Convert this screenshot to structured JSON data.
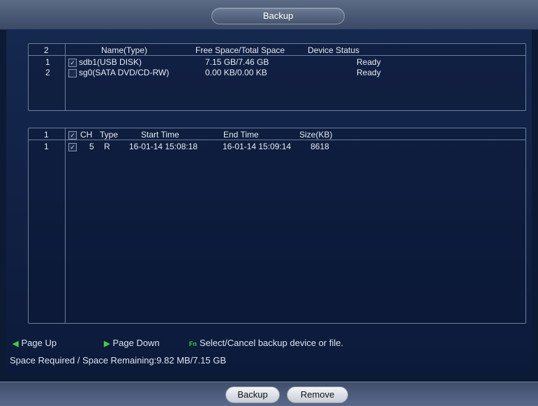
{
  "window": {
    "title": "Backup"
  },
  "devices": {
    "header": {
      "count": "2",
      "name": "Name(Type)",
      "space": "Free Space/Total Space",
      "status": "Device Status"
    },
    "rows": [
      {
        "index": "1",
        "checked": true,
        "name": "sdb1(USB DISK)",
        "space": "7.15 GB/7.46 GB",
        "status": "Ready"
      },
      {
        "index": "2",
        "checked": false,
        "name": "sg0(SATA DVD/CD-RW)",
        "space": "0.00 KB/0.00 KB",
        "status": "Ready"
      }
    ]
  },
  "files": {
    "header": {
      "count": "1",
      "checked": true,
      "ch": "CH",
      "type": "Type",
      "start": "Start Time",
      "end": "End Time",
      "size": "Size(KB)"
    },
    "rows": [
      {
        "index": "1",
        "checked": true,
        "ch": "5",
        "type": "R",
        "start": "16-01-14 15:08:18",
        "end": "16-01-14 15:09:14",
        "size": "8618"
      }
    ]
  },
  "footer": {
    "page_up": "Page Up",
    "page_down": "Page Down",
    "fn_hint": "Select/Cancel backup device or file.",
    "space_info": "Space Required / Space Remaining:9.82 MB/7.15 GB",
    "icons": {
      "page_up": "◀",
      "page_down": "▶",
      "fn": "Fn"
    }
  },
  "buttons": {
    "backup": "Backup",
    "remove": "Remove"
  },
  "colors": {
    "accent_green": "#3fd13f",
    "background": "#0d1a33"
  }
}
